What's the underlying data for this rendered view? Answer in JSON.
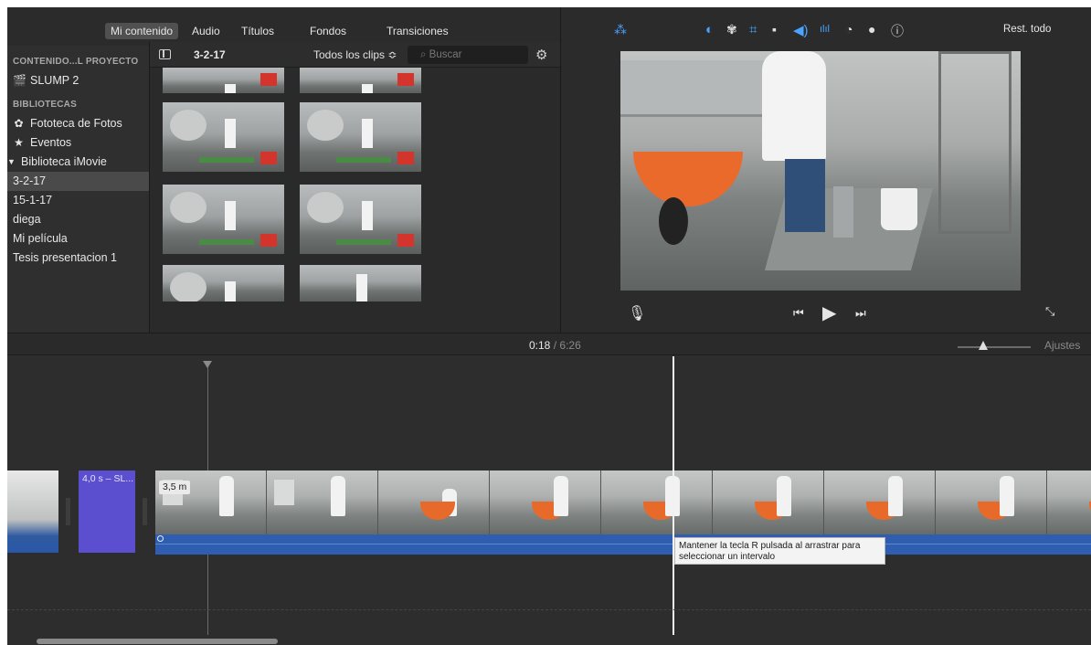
{
  "top_tabs": [
    "Mi contenido",
    "Audio",
    "Títulos",
    "Fondos",
    "Transiciones"
  ],
  "sidebar": {
    "project_header": "CONTENIDO...L PROYECTO",
    "project_item": "SLUMP 2",
    "libraries_header": "BIBLIOTECAS",
    "items": [
      {
        "label": "Fototeca de Fotos",
        "icon": "photos-icon"
      },
      {
        "label": "Eventos",
        "icon": "star-icon"
      },
      {
        "label": "Biblioteca iMovie",
        "icon": "disclosure-triangle-icon"
      }
    ],
    "events": [
      "3-2-17",
      "15-1-17",
      "diega",
      "Mi película",
      "Tesis presentacion 1"
    ],
    "selected_event": "3-2-17"
  },
  "browser": {
    "event_name": "3-2-17",
    "clip_filter": "Todos los clips ≎",
    "search_placeholder": "Buscar"
  },
  "viewer": {
    "reset_label": "Rest. todo",
    "tool_icons": [
      "magic-wand-icon",
      "color-balance-icon",
      "color-palette-icon",
      "crop-icon",
      "stabilization-icon",
      "volume-icon",
      "equalizer-icon",
      "speed-icon",
      "filter-icon",
      "info-icon"
    ]
  },
  "timeline": {
    "current_time": "0:18",
    "separator": "/",
    "total_time": "6:26",
    "settings_label": "Ajustes",
    "title_clip_label": "4,0 s – SL...",
    "clip_duration": "3,5 m",
    "tooltip": "Mantener la tecla R pulsada al arrastrar para seleccionar un intervalo"
  },
  "colors": {
    "accent": "#4aa3ff",
    "title_clip": "#5b4fd0",
    "audio": "#2f5db0"
  }
}
